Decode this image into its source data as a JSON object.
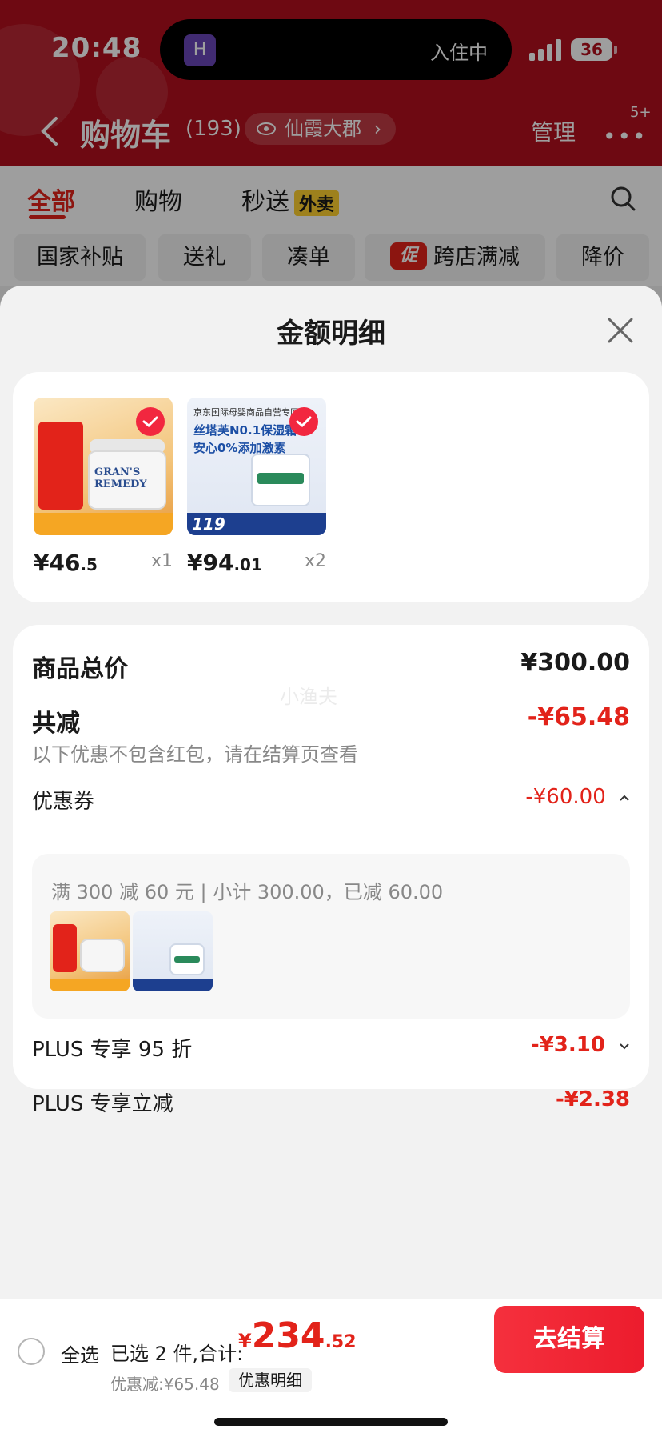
{
  "status": {
    "time": "20:48",
    "island_app": "H",
    "island_text": "入住中",
    "battery": "36"
  },
  "nav": {
    "title": "购物车",
    "count": "(193)",
    "address": "仙霞大郡",
    "manage": "管理",
    "more_badge": "5+"
  },
  "tabs": {
    "all": "全部",
    "shopping": "购物",
    "express": "秒送",
    "takeout": "外卖"
  },
  "chips": {
    "subsidy": "国家补贴",
    "gift": "送礼",
    "bundle": "凑单",
    "promo_tag": "促",
    "cross_store": "跨店满减",
    "price_drop": "降价"
  },
  "sheet": {
    "title": "金额明细"
  },
  "products": [
    {
      "price_int": "¥46",
      "price_dec": ".5",
      "qty": "x1",
      "image_label": "GRAN'S REMEDY"
    },
    {
      "price_int": "¥94",
      "price_dec": ".01",
      "qty": "x2",
      "image_header": "京东国际母婴商品自营专区",
      "image_line1": "丝塔芙N0.1保湿霜",
      "image_line2": "安心0%添加激素",
      "image_price": "119"
    }
  ],
  "detail": {
    "total_label": "商品总价",
    "total_value": "¥300.00",
    "watermark": "小渔夫",
    "reduce_label": "共减",
    "reduce_value": "-¥65.48",
    "reduce_note": "以下优惠不包含红包，请在结算页查看",
    "coupon_label": "优惠券",
    "coupon_value": "-¥60.00",
    "coupon_desc": "满 300 减 60 元 | 小计 300.00，已减 60.00",
    "plus95_label": "PLUS 专享 95 折",
    "plus95_value": "-¥3.10",
    "plus_direct_label": "PLUS 专享立减",
    "plus_direct_value": "-¥2.38"
  },
  "bottom": {
    "select_all": "全选",
    "summary": "已选 2 件,合计:",
    "currency": "¥",
    "total_int": "234",
    "total_dec": ".52",
    "discount": "优惠减:¥65.48",
    "detail_link": "优惠明细",
    "checkout": "去结算"
  }
}
